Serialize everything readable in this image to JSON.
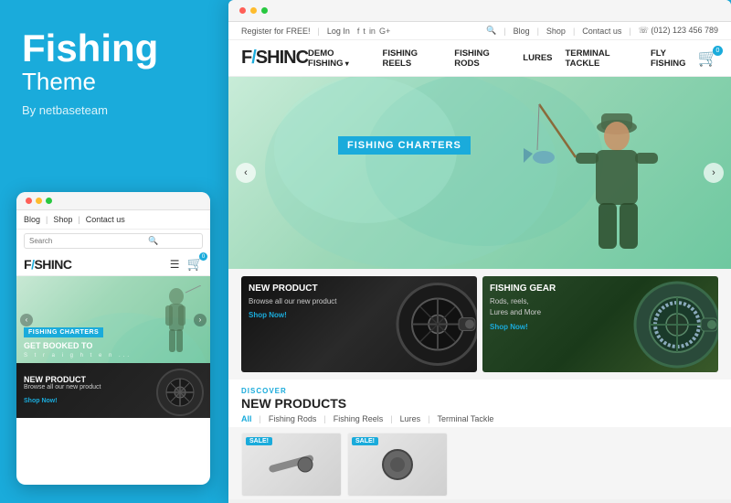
{
  "left": {
    "title": "Fishing",
    "subtitle": "Theme",
    "author": "By netbaseteam"
  },
  "mobile": {
    "nav_links": [
      "Blog",
      "Shop",
      "Contact us"
    ],
    "search_placeholder": "Search",
    "logo": "F/SHINC",
    "cart_badge": "0",
    "hero_label": "FISHING CHARTERS",
    "hero_sub": "GET BOOKED TO",
    "hero_tagline": "S t r a i g h t e n ...",
    "product_banner_title": "NEW PRODUCT",
    "product_banner_sub": "Browse all our new product",
    "product_banner_cta": "Shop Now!"
  },
  "desktop": {
    "utility_left": {
      "register": "Register for FREE!",
      "login": "Log In"
    },
    "utility_right": {
      "blog": "Blog",
      "shop": "Shop",
      "contact": "Contact us",
      "phone": "☏ (012) 123 456 789"
    },
    "social": [
      "f",
      "t",
      "in",
      "G+"
    ],
    "logo": "F/SHINC",
    "cart_badge": "0",
    "nav_items": [
      {
        "label": "DEMO FISHING",
        "has_arrow": true
      },
      {
        "label": "FISHING REELS",
        "has_arrow": false
      },
      {
        "label": "FISHING RODS",
        "has_arrow": false
      },
      {
        "label": "LURES",
        "has_arrow": false
      },
      {
        "label": "TERMINAL TACKLE",
        "has_arrow": false
      },
      {
        "label": "FLY FISHING",
        "has_arrow": false
      }
    ],
    "hero_label": "FISHING CHARTERS",
    "banners": [
      {
        "title": "NEW PRODUCT",
        "sub": "Browse all our new product",
        "cta": "Shop Now!"
      },
      {
        "title": "FISHING GEAR",
        "sub": "Rods, reels,\nLures and More",
        "cta": "Shop Now!"
      }
    ],
    "discover_label": "DISCOVER",
    "section_title": "NEW PRODUCTS",
    "filter_tabs": [
      "All",
      "Fishing Rods",
      "Fishing Reels",
      "Lures",
      "Terminal Tackle"
    ],
    "filter_active": "All",
    "sale_badge": "SALE!"
  }
}
